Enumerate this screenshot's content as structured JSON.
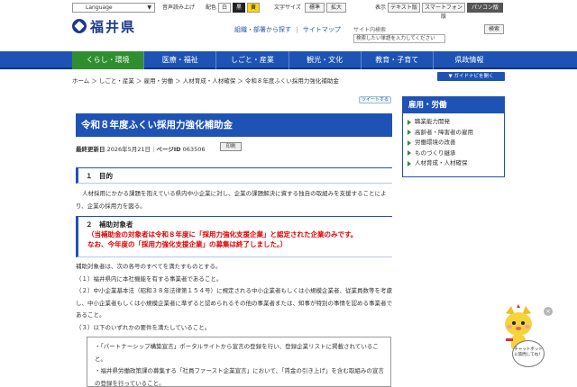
{
  "util": {
    "language": "Language",
    "audio": "音声読み上げ",
    "color_label": "配色",
    "color_white": "白",
    "color_black": "黒",
    "color_yellow": "黄",
    "fontsize_label": "文字サイズ",
    "fontsize_std": "標準",
    "fontsize_large": "拡大",
    "display_label": "表示",
    "text_ver": "テキスト版",
    "smartphone": "スマートフォン版",
    "pc": "パソコン版"
  },
  "header": {
    "logo": "福井県",
    "link_org": "組織・部署から探す",
    "sep": "|",
    "link_sitemap": "サイトマップ",
    "search_label": "サイト内検索",
    "search_placeholder": "検索したい単語を入力してください",
    "search_button": "検索"
  },
  "nav": {
    "items": [
      "くらし・環境",
      "医療・福祉",
      "しごと・産業",
      "観光・文化",
      "教育・子育て",
      "県政情報"
    ]
  },
  "breadcrumb": "ホーム ＞ しごと・産業 ＞ 雇用・労働 ＞ 人材育成・人材確保 ＞ 令和８年度ふくい採用力強化補助金",
  "guide_button": "▼ ガイドナビを開く",
  "tweet": "ツイートする",
  "article": {
    "title": "令和８年度ふくい採用力強化補助金",
    "updated_label": "最終更新日",
    "updated": "2026年5月21日",
    "page_id_label": "ページID",
    "page_id": "063506",
    "print": "印刷",
    "s1_heading": "１　目的",
    "s1_text": "人材採用にかかる課題を抱えている県内中小企業に対し、企業の課題解決に資する独自の取組みを支援することにより、企業の採用力を図る。",
    "s2_heading": "２　補助対象者",
    "s2_red1": "（当補助金の対象者は令和８年度に「採用力強化支援企業」と認定された企業のみです。",
    "s2_red2": "なお、今年度の「採用力強化支援企業」の募集は終了しました。）",
    "s2_line1": "補助対象者は、次の各号のすべてを満たすものとする。",
    "s2_line2": "（１）福井県内に本社機能を有する事業者であること。",
    "s2_line3": "（２）中小企業基本法（昭和３８年法律第１５４号）に規定される中小企業者もしくは小規模企業者、従業員数等を考慮し、中小企業者もしくは小規模企業者に準ずると認められるその他の事業者または、知事が特別の事情を認める事業者であること。",
    "s2_line4": "（３）以下のいずれかの要件を満たしていること。",
    "note1": "・「パートナーシップ構築宣言」ポータルサイトから宣言の登録を行い、登録企業リストに掲載されていること。",
    "note2": "・福井県労働政策課の募集する「社員ファースト企業宣言」において、「賃金の引き上げ」を含む取組みの宣言の登録を行っていること。"
  },
  "sidebar": {
    "heading": "雇用・労働",
    "items": [
      "職業能力開発",
      "高齢者・障害者の雇用",
      "労働環境の改善",
      "ものづくり継承",
      "人材育成・人材確保"
    ]
  },
  "chatbot": {
    "bubble": "チャットボットに質問してね！"
  },
  "colors": {
    "brand_blue": "#1e53b5",
    "active_green": "#2f8f2f",
    "alert_red": "#e00000"
  }
}
